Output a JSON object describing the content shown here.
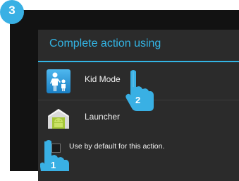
{
  "step": {
    "number": "3"
  },
  "dialog": {
    "title": "Complete action using",
    "options": [
      {
        "label": "Kid Mode",
        "icon": "kid-mode-app-icon"
      },
      {
        "label": "Launcher",
        "icon": "android-launcher-icon"
      }
    ],
    "default_checkbox": {
      "label": "Use by default for this action.",
      "checked": false
    }
  },
  "annotations": {
    "hand_1": {
      "number": "1",
      "icon": "tapping-hand-icon"
    },
    "hand_2": {
      "number": "2",
      "icon": "tapping-hand-icon"
    }
  },
  "colors": {
    "accent": "#33b5e5",
    "badge": "#39b0e4",
    "screen_bg": "#121212",
    "dialog_bg": "#2b2b2b"
  }
}
